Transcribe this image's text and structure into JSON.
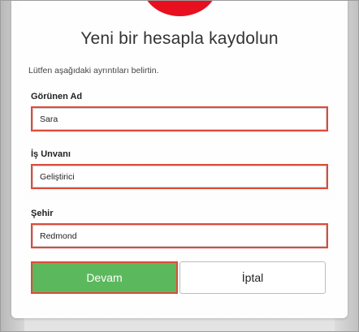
{
  "header": {
    "title": "Yeni bir hesapla kaydolun",
    "instructions": "Lütfen aşağıdaki ayrıntıları belirtin."
  },
  "form": {
    "display_name": {
      "label": "Görünen Ad",
      "value": "Sara"
    },
    "job_title": {
      "label": "İş Unvanı",
      "value": "Geliştirici"
    },
    "city": {
      "label": "Şehir",
      "value": "Redmond"
    }
  },
  "actions": {
    "continue_label": "Devam",
    "cancel_label": "İptal"
  },
  "colors": {
    "brand": "#e8101f",
    "continue_button": "#5cb85c",
    "highlight_border": "#e04a3a"
  }
}
